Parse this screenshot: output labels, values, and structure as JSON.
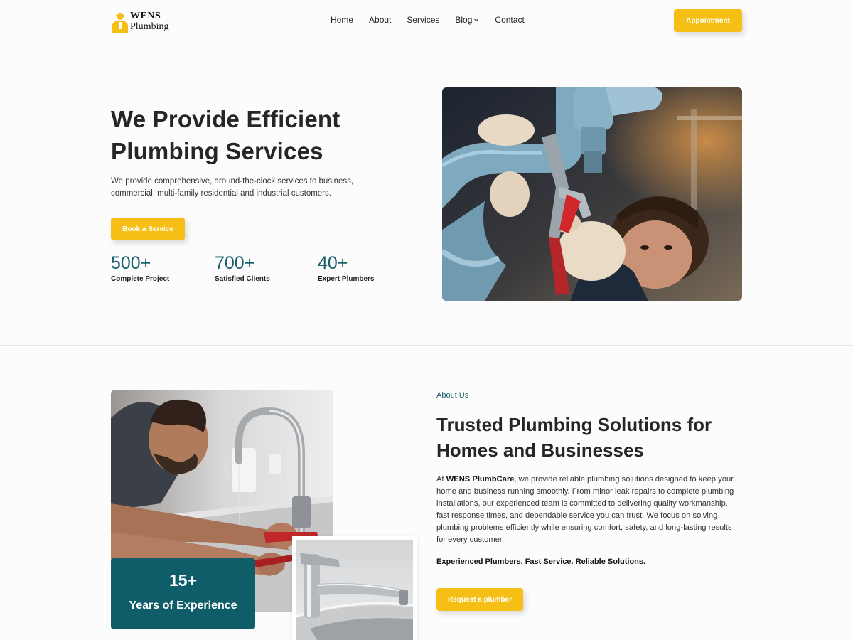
{
  "header": {
    "logo_line1": "WENS",
    "logo_line2": "Plumbing",
    "nav": [
      "Home",
      "About",
      "Services",
      "Blog",
      "Contact"
    ],
    "appointment_label": "Appointment"
  },
  "hero": {
    "title": "We Provide Efficient Plumbing Services",
    "description": "We provide comprehensive, around-the-clock services to business, commercial, multi-family residential and industrial customers.",
    "cta_label": "Book a Service",
    "stats": [
      {
        "value": "500+",
        "label": "Complete Project"
      },
      {
        "value": "700+",
        "label": "Satisfied Clients"
      },
      {
        "value": "40+",
        "label": "Expert Plumbers"
      }
    ]
  },
  "about": {
    "tag": "About Us",
    "title": "Trusted Plumbing Solutions for Homes and Businesses",
    "desc_prefix": "At ",
    "desc_brand": "WENS PlumbCare",
    "desc_rest": ", we provide reliable plumbing solutions designed to keep your home and business running smoothly. From minor leak repairs to complete plumbing installations, our experienced team is committed to delivering quality workmanship, fast response times, and dependable service you can trust. We focus on solving plumbing problems efficiently while ensuring comfort, safety, and long-lasting results for every customer.",
    "tagline": "Experienced Plumbers. Fast Service. Reliable Solutions.",
    "cta_label": "Request a plumber",
    "experience_value": "15+",
    "experience_label": "Years of Experience"
  },
  "colors": {
    "accent_yellow": "#f5bf16",
    "brand_teal": "#0e5d68",
    "stat_teal": "#1b5f6e"
  },
  "icons": [
    "plumber-logo-icon",
    "chevron-down-icon"
  ]
}
